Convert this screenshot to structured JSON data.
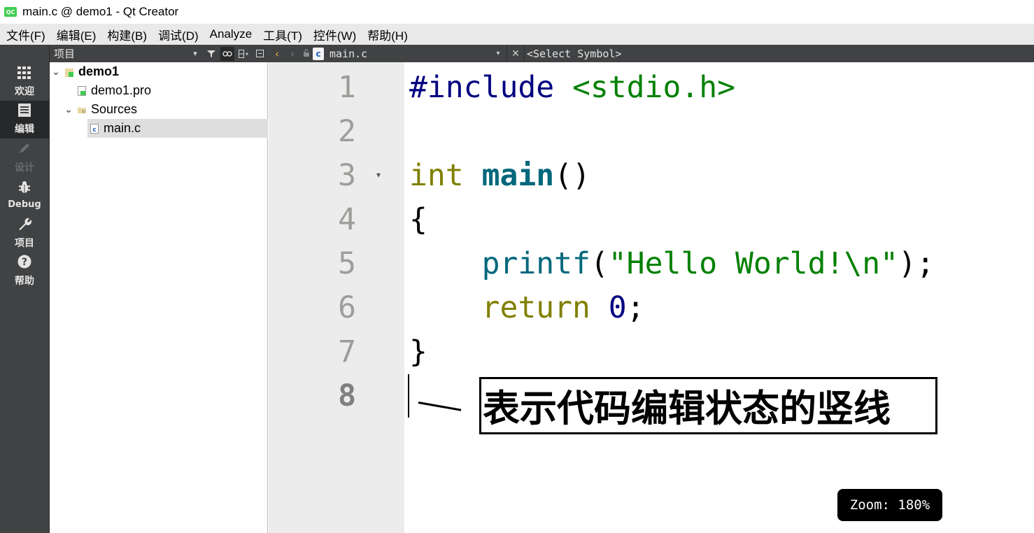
{
  "window": {
    "title": "main.c @ demo1 - Qt Creator",
    "app_icon": "QC"
  },
  "menu": [
    "文件(F)",
    "编辑(E)",
    "构建(B)",
    "调试(D)",
    "Analyze",
    "工具(T)",
    "控件(W)",
    "帮助(H)"
  ],
  "modes": [
    {
      "label": "欢迎",
      "icon": "grid-icon"
    },
    {
      "label": "编辑",
      "icon": "document-icon"
    },
    {
      "label": "设计",
      "icon": "pencil-icon"
    },
    {
      "label": "Debug",
      "icon": "bug-icon"
    },
    {
      "label": "项目",
      "icon": "wrench-icon"
    },
    {
      "label": "帮助",
      "icon": "help-icon"
    }
  ],
  "project_pane": {
    "title": "项目",
    "tree": [
      {
        "label": "demo1",
        "icon": "project-icon"
      },
      {
        "label": "demo1.pro",
        "icon": "pro-file-icon"
      },
      {
        "label": "Sources",
        "icon": "folder-icon"
      },
      {
        "label": "main.c",
        "icon": "c-file-icon"
      }
    ]
  },
  "editor": {
    "file_name": "main.c",
    "symbol": "<Select Symbol>",
    "line_numbers": [
      "1",
      "2",
      "3",
      "4",
      "5",
      "6",
      "7",
      "8"
    ],
    "code": {
      "l1_pre": "#include ",
      "l1_str": "<stdio.h>",
      "l3_kw": "int ",
      "l3_fn": "main",
      "l3_rest": "()",
      "l4": "{",
      "l5_indent": "    ",
      "l5_fn": "printf",
      "l5_open": "(",
      "l5_str": "\"Hello World!\\n\"",
      "l5_close": ");",
      "l6_indent": "    ",
      "l6_kw": "return ",
      "l6_num": "0",
      "l6_end": ";",
      "l7": "}"
    }
  },
  "annotation": {
    "text": "表示代码编辑状态的竖线"
  },
  "zoom": {
    "label": "Zoom: 180%"
  },
  "colors": {
    "preprocessor": "#000080",
    "string": "#008000",
    "keyword": "#808000",
    "function": "#00677c",
    "sidebar": "#404244"
  }
}
